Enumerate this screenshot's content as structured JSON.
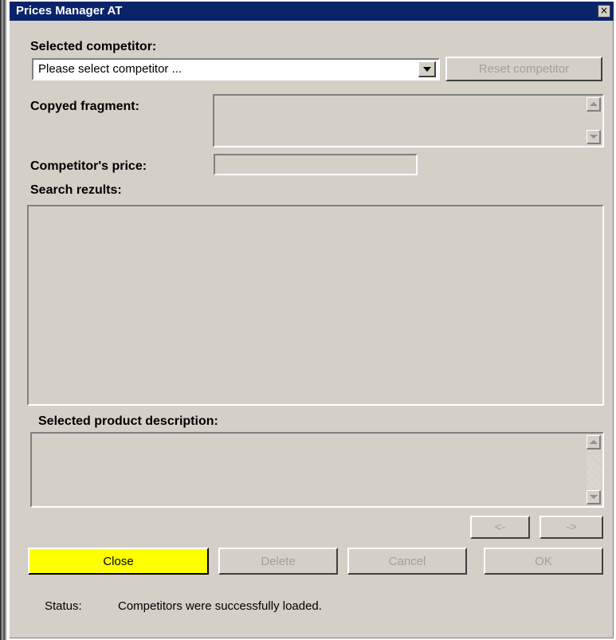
{
  "window": {
    "title": "Prices Manager AT",
    "close_glyph": "×"
  },
  "competitor": {
    "label": "Selected competitor:",
    "selected_value": "Please select competitor ...",
    "reset_button": "Reset competitor"
  },
  "fragment": {
    "label": "Copyed fragment:",
    "value": ""
  },
  "price": {
    "label": "Competitor's price:",
    "value": ""
  },
  "search": {
    "label": "Search rezults:"
  },
  "description": {
    "label": "Selected product description:",
    "value": ""
  },
  "nav": {
    "prev_label": "<-",
    "next_label": "->"
  },
  "actions": {
    "close": "Close",
    "delete": "Delete",
    "cancel": "Cancel",
    "ok": "OK"
  },
  "status": {
    "label": "Status:",
    "text": "Competitors were successfully loaded."
  },
  "colors": {
    "titlebar": "#0a246a",
    "window_bg": "#d4d0c8",
    "close_button_bg": "#ffff00",
    "disabled_text": "#a0a0a0"
  }
}
